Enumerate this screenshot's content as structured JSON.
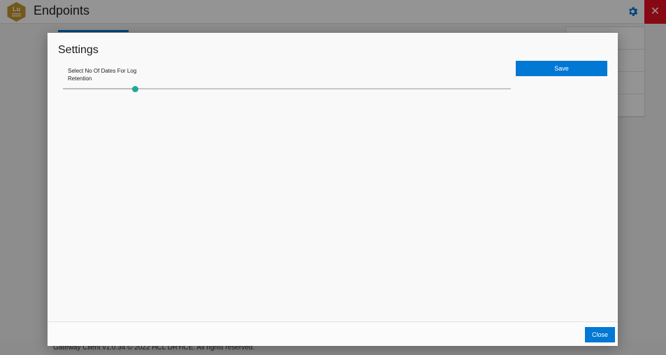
{
  "app": {
    "title": "Endpoints",
    "logo_text": "Lu",
    "footer_text": "Gateway Client v1.0.34 © 2022 HCL DRYiCE. All rights reserved."
  },
  "icons": {
    "logo": "hexagon-logo-icon",
    "settings": "gear-icon",
    "close": "close-icon"
  },
  "dialog": {
    "title": "Settings",
    "log_retention": {
      "label": "Select No Of Dates For Log Retention",
      "value_fraction": 0.16
    },
    "save_label": "Save",
    "close_label": "Close"
  },
  "colors": {
    "accent": "#0078d4",
    "slider_thumb": "#26a69a",
    "close_window": "#e81123",
    "logo": "#c8962e"
  }
}
